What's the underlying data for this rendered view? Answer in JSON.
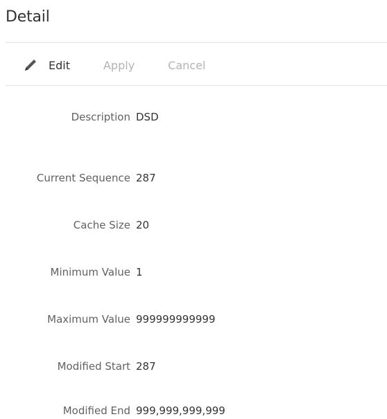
{
  "panel": {
    "title": "Detail"
  },
  "toolbar": {
    "edit_label": "Edit",
    "apply_label": "Apply",
    "cancel_label": "Cancel",
    "edit_icon": "pencil-icon"
  },
  "fields": {
    "description": {
      "label": "Description",
      "value": "DSD"
    },
    "current_sequence": {
      "label": "Current Sequence",
      "value": "287"
    },
    "cache_size": {
      "label": "Cache Size",
      "value": "20"
    },
    "minimum_value": {
      "label": "Minimum Value",
      "value": "1"
    },
    "maximum_value": {
      "label": "Maximum Value",
      "value": "999999999999"
    },
    "modified_start": {
      "label": "Modified Start",
      "value": "287"
    },
    "modified_end": {
      "label": "Modified End",
      "value": "999,999,999,999"
    }
  },
  "colors": {
    "text": "#333333",
    "label": "#616161",
    "disabled": "#b3b3b3",
    "divider": "#e3e3e3"
  }
}
